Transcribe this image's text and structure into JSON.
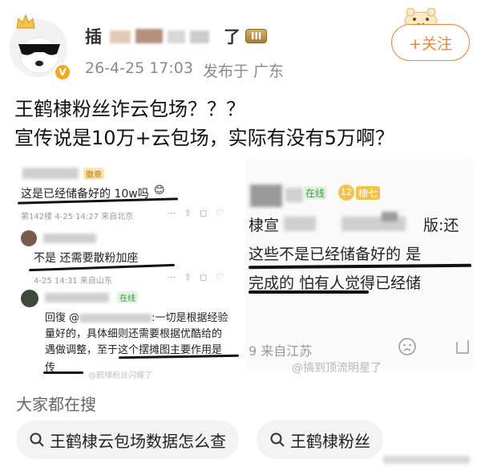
{
  "header": {
    "username_visible": "插",
    "username_tail": "了",
    "level_badge": "III",
    "timestamp": "26-4-25 17:03",
    "location": "发布于 广东",
    "follow_label": "+关注"
  },
  "post": {
    "line1": "王鹤棣粉丝诈云包场？？？",
    "line2": "宣传说是10万+云包场，实际有没有5万啊？"
  },
  "left_image": {
    "comment1": "这是已经储备好的 10w吗",
    "comment1_meta": "第142楼 4-25 14:27 来自北京",
    "comment1_tag": "徽章",
    "comment2": "不是 还需要散粉加座",
    "comment2_meta": "4-25 14:31 来自山东",
    "comment3_tag": "在线",
    "comment3_line1": "回復 @",
    "comment3_line1_tail": ":一切是根据经验",
    "comment3_line2": "量好的，具体细则还需要根据优酷给的",
    "comment3_line3": "遇做调整，至于这个摆摊图主要作用是",
    "comment3_line4": "传",
    "comment3_meta": "@鹤棣粉丝闪耀了"
  },
  "right_image": {
    "online_tag": "在线",
    "level_tag": "12",
    "title_tag": "棣七",
    "line1_head": "棣宣",
    "line1_tail": "版:还",
    "line2": "这些不是已经储备好的 是",
    "line3": "完成的 怕有人觉得已经储",
    "meta": "9 来自江苏"
  },
  "watermark": "@搞到顶流明星了",
  "search": {
    "title": "大家都在搜",
    "chips": [
      "王鹤棣云包场数据怎么查",
      "王鹤棣粉丝"
    ]
  },
  "icons": [
    "crown-icon",
    "verified-icon",
    "mascot-icon",
    "search-icon",
    "sad-face-icon",
    "share-icon",
    "comment-icon",
    "like-icon"
  ]
}
